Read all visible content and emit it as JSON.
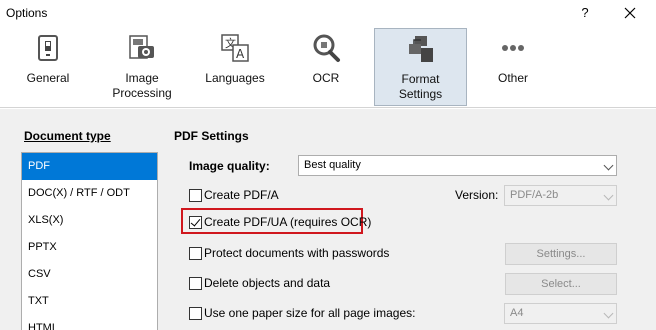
{
  "window": {
    "title": "Options",
    "help_label": "?",
    "close_label": "✕"
  },
  "toolbar": {
    "items": [
      {
        "label": "General",
        "icon": "general-icon"
      },
      {
        "label": "Image\nProcessing",
        "icon": "image-processing-icon"
      },
      {
        "label": "Languages",
        "icon": "languages-icon"
      },
      {
        "label": "OCR",
        "icon": "ocr-icon"
      },
      {
        "label": "Format\nSettings",
        "icon": "format-settings-icon",
        "active": true
      },
      {
        "label": "Other",
        "icon": "more-icon"
      }
    ]
  },
  "document_type": {
    "heading": "Document type",
    "items": [
      "PDF",
      "DOC(X) / RTF / ODT",
      "XLS(X)",
      "PPTX",
      "CSV",
      "TXT",
      "HTML"
    ],
    "selected": "PDF"
  },
  "pdf_settings": {
    "heading": "PDF Settings",
    "image_quality_label": "Image quality:",
    "image_quality_value": "Best quality",
    "create_pdfa_label": "Create PDF/A",
    "create_pdfa_checked": false,
    "version_label": "Version:",
    "version_value": "PDF/A-2b",
    "create_pdfua_label": "Create PDF/UA (requires OCR)",
    "create_pdfua_checked": true,
    "protect_label": "Protect documents with passwords",
    "protect_checked": false,
    "settings_button": "Settings...",
    "delete_label": "Delete objects and data",
    "delete_checked": false,
    "select_button": "Select...",
    "paper_label": "Use one paper size for all page images:",
    "paper_checked": false,
    "paper_value": "A4"
  },
  "colors": {
    "selection": "#0078d7",
    "highlight": "#d0171e",
    "active_tab": "#dde6ef"
  }
}
